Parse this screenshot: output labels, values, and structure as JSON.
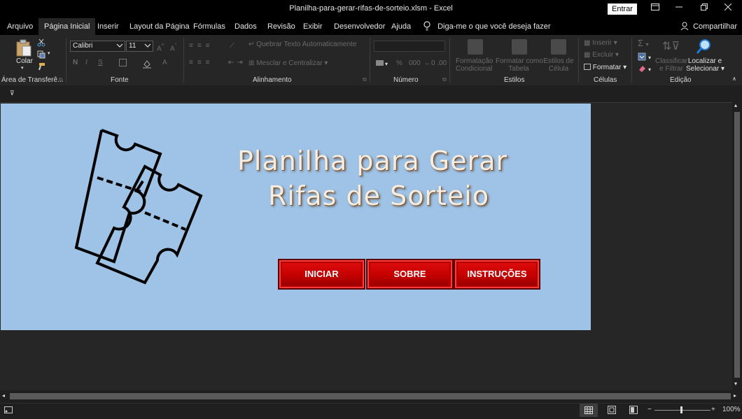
{
  "window": {
    "title": "Planilha-para-gerar-rifas-de-sorteio.xlsm  -  Excel",
    "signin": "Entrar"
  },
  "tabs": [
    "Arquivo",
    "Página Inicial",
    "Inserir",
    "Layout da Página",
    "Fórmulas",
    "Dados",
    "Revisão",
    "Exibir",
    "Desenvolvedor",
    "Ajuda"
  ],
  "tellme": "Diga-me o que você deseja fazer",
  "share": "Compartilhar",
  "ribbon": {
    "clipboard": {
      "paste": "Colar",
      "label": "Área de Transferê..."
    },
    "font": {
      "name": "Calibri",
      "size": "11",
      "label": "Fonte"
    },
    "alignment": {
      "wrap": "Quebrar Texto Automaticamente",
      "merge": "Mesclar e Centralizar",
      "label": "Alinhamento"
    },
    "number": {
      "label": "Número"
    },
    "styles": {
      "cond": [
        "Formatação",
        "Condicional"
      ],
      "table": [
        "Formatar como",
        "Tabela"
      ],
      "cell": [
        "Estilos de",
        "Célula"
      ],
      "label": "Estilos"
    },
    "cells": {
      "insert": "Inserir",
      "delete": "Excluir",
      "format": "Formatar",
      "label": "Células"
    },
    "editing": {
      "sort": [
        "Classificar",
        "e Filtrar"
      ],
      "find": [
        "Localizar e",
        "Selecionar"
      ],
      "label": "Edição"
    }
  },
  "sheet": {
    "title_line1": "Planilha para Gerar",
    "title_line2": "Rifas de Sorteio",
    "buttons": {
      "start": "INICIAR",
      "about": "SOBRE",
      "instructions": "INSTRUÇÕES"
    }
  },
  "status": {
    "zoom": "100%"
  },
  "colors": {
    "sheet_bg": "#9ec3e6",
    "button_red": "#c40000",
    "app_bg": "#1f1f1f"
  }
}
